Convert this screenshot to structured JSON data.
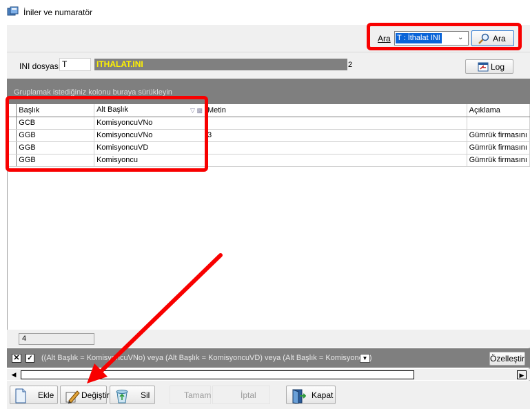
{
  "window": {
    "title": "İniler ve numaratör"
  },
  "search": {
    "label": "Ara",
    "combo_value": "T : İthalat INI",
    "button_label": "Ara"
  },
  "ini": {
    "label": "INI dosyası",
    "code": "T",
    "filename": "ITHALAT.INI",
    "suffix": "2",
    "log_label": "Log"
  },
  "grid": {
    "group_panel_text": "Gruplamak istediğiniz kolonu buraya sürükleyin",
    "columns": [
      "Başlık",
      "Alt Başlık",
      "Metin",
      "Açıklama"
    ],
    "rows": [
      [
        "GCB",
        "KomisyoncuVNo",
        "",
        ""
      ],
      [
        "GGB",
        "KomisyoncuVNo",
        "3",
        "Gümrük firmasını"
      ],
      [
        "GGB",
        "KomisyoncuVD",
        "",
        "Gümrük firmasını"
      ],
      [
        "GGB",
        "Komisyoncu",
        "",
        "Gümrük firmasını"
      ]
    ],
    "record_count": "4"
  },
  "filter": {
    "expression": "((Alt Başlık = KomisyoncuVNo) veya (Alt Başlık = KomisyoncuVD) veya (Alt Başlık = Komisyoncu))",
    "customize_label": "Özelleştir"
  },
  "toolbar": {
    "add_label": "Ekle",
    "edit_label": "Değiştir",
    "delete_label": "Sil",
    "ok_label": "Tamam",
    "cancel_label": "İptal",
    "close_label": "Kapat"
  },
  "annotation_color": "#f80000",
  "selection_color": "#0a64d8"
}
